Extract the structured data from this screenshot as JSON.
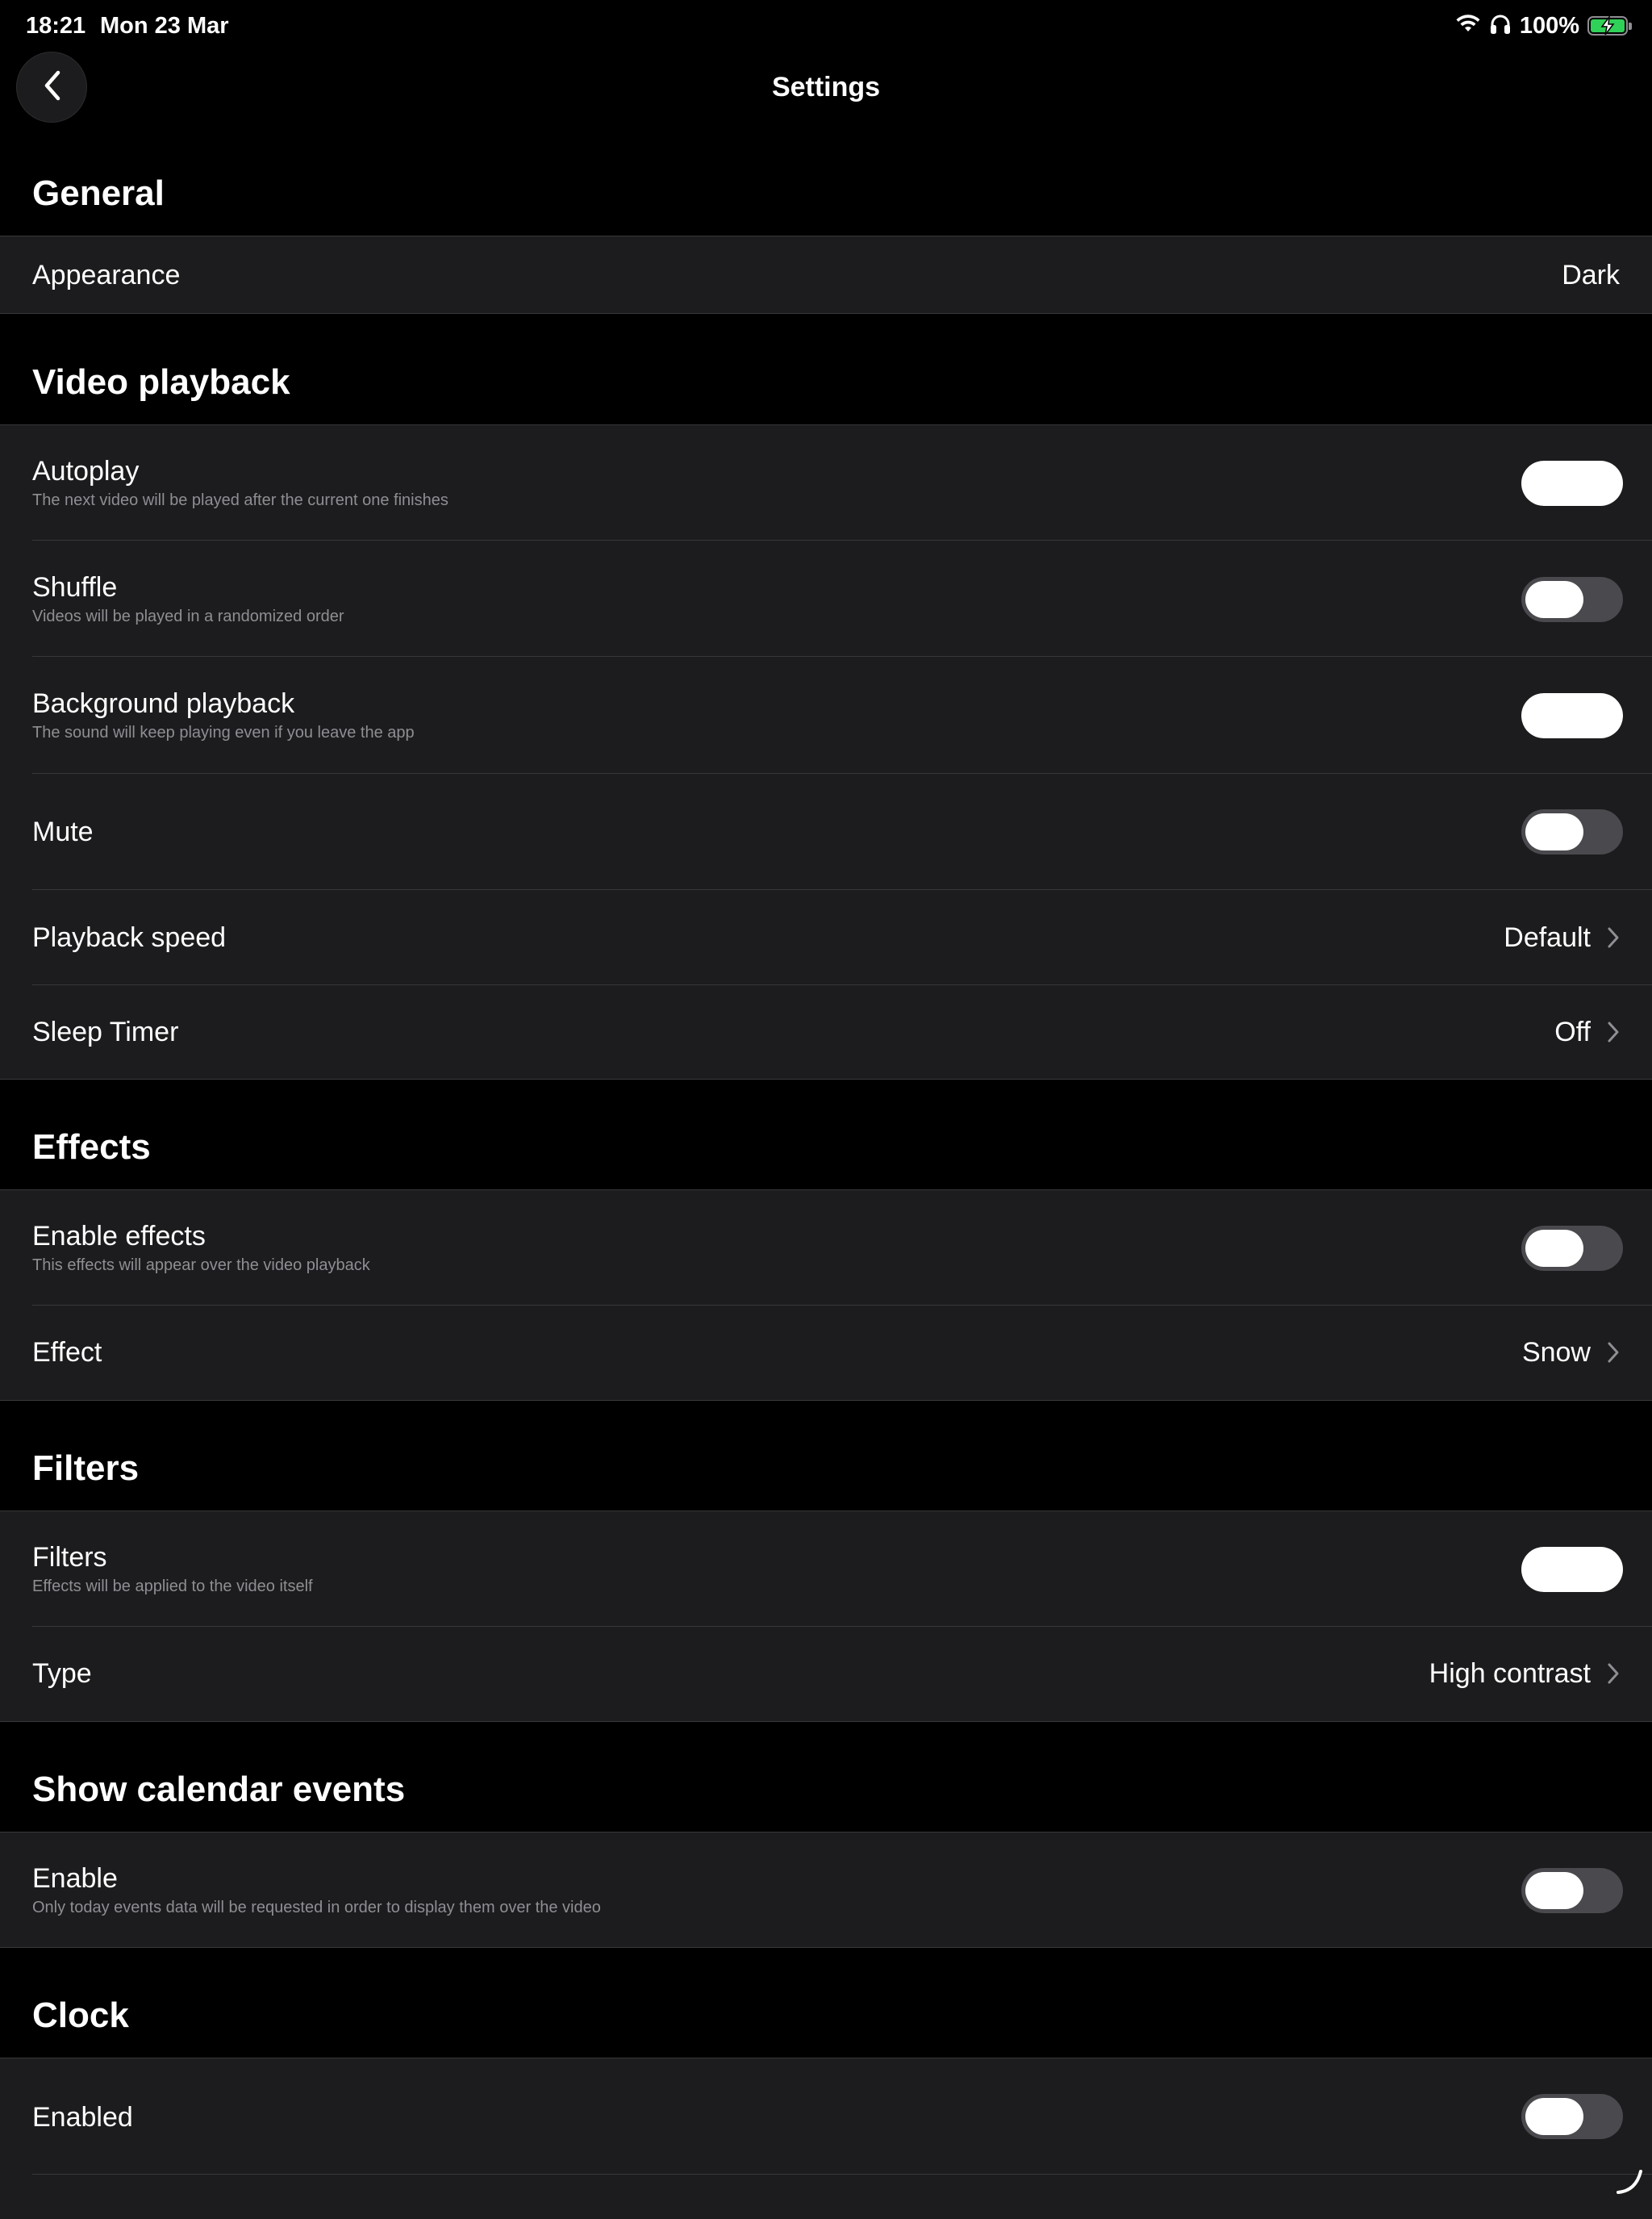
{
  "status_bar": {
    "time": "18:21",
    "date": "Mon 23 Mar",
    "battery_percent": "100%",
    "icons": [
      "wifi-icon",
      "headphones-icon",
      "battery-charging-icon"
    ],
    "battery_color": "#30d158"
  },
  "nav": {
    "title": "Settings",
    "back_icon": "chevron-left-icon"
  },
  "sections": {
    "general": {
      "header": "General",
      "appearance": {
        "label": "Appearance",
        "value": "Dark"
      }
    },
    "video_playback": {
      "header": "Video playback",
      "autoplay": {
        "label": "Autoplay",
        "subtitle": "The next video will be played after the current one finishes",
        "on": true
      },
      "shuffle": {
        "label": "Shuffle",
        "subtitle": "Videos will be played in a randomized order",
        "on": false
      },
      "background": {
        "label": "Background playback",
        "subtitle": "The sound will keep playing even if you leave the app",
        "on": true
      },
      "mute": {
        "label": "Mute",
        "on": false
      },
      "speed": {
        "label": "Playback speed",
        "value": "Default"
      },
      "sleep": {
        "label": "Sleep Timer",
        "value": "Off"
      }
    },
    "effects": {
      "header": "Effects",
      "enable": {
        "label": "Enable effects",
        "subtitle": "This effects will appear over the video playback",
        "on": false
      },
      "effect": {
        "label": "Effect",
        "value": "Snow"
      }
    },
    "filters": {
      "header": "Filters",
      "filters": {
        "label": "Filters",
        "subtitle": "Effects will be applied to the video itself",
        "on": true
      },
      "type": {
        "label": "Type",
        "value": "High contrast"
      }
    },
    "calendar": {
      "header": "Show calendar events",
      "enable": {
        "label": "Enable",
        "subtitle": "Only today events data will be requested in order to display them over the video",
        "on": false
      }
    },
    "clock": {
      "header": "Clock",
      "enabled": {
        "label": "Enabled",
        "on": false
      }
    }
  },
  "colors": {
    "background": "#000000",
    "cell": "#1c1c1e",
    "separator": "#38383a",
    "secondary_text": "#8e8e93",
    "toggle_off": "#4a4a4e",
    "toggle_on": "#ffffff"
  }
}
